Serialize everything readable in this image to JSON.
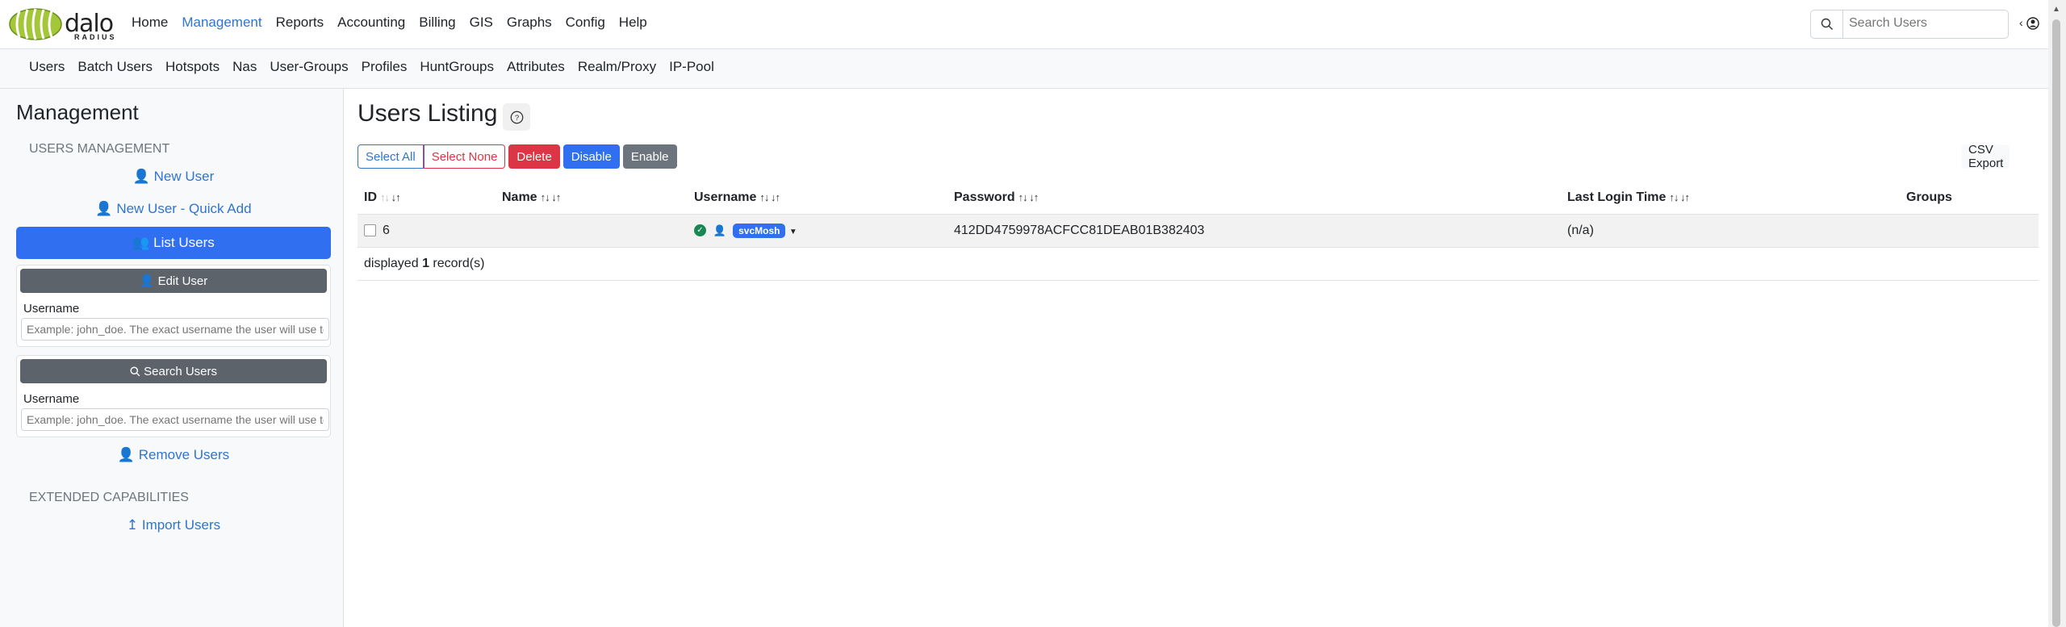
{
  "brand": {
    "logo_text": "dalo",
    "logo_sub": "RADIUS"
  },
  "main_nav": [
    "Home",
    "Management",
    "Reports",
    "Accounting",
    "Billing",
    "GIS",
    "Graphs",
    "Config",
    "Help"
  ],
  "main_nav_active": "Management",
  "search": {
    "placeholder": "Search Users"
  },
  "sub_nav": [
    "Users",
    "Batch Users",
    "Hotspots",
    "Nas",
    "User-Groups",
    "Profiles",
    "HuntGroups",
    "Attributes",
    "Realm/Proxy",
    "IP-Pool"
  ],
  "sidebar": {
    "title": "Management",
    "section_users": "USERS MANAGEMENT",
    "new_user": "New User",
    "new_user_quick": "New User - Quick Add",
    "list_users": "List Users",
    "edit_user": {
      "button": "Edit User",
      "label": "Username",
      "placeholder": "Example: john_doe. The exact username the user will use to log in"
    },
    "search_users": {
      "button": "Search Users",
      "label": "Username",
      "placeholder": "Example: john_doe. The exact username the user will use to log in"
    },
    "remove_users": "Remove Users",
    "section_extended": "EXTENDED CAPABILITIES",
    "import_users": "Import Users"
  },
  "content": {
    "title": "Users Listing",
    "buttons": {
      "select_all": "Select All",
      "select_none": "Select None",
      "delete": "Delete",
      "disable": "Disable",
      "enable": "Enable",
      "csv_export": "CSV Export"
    },
    "columns": [
      "ID",
      "Name",
      "Username",
      "Password",
      "Last Login Time",
      "Groups"
    ],
    "rows": [
      {
        "id": "6",
        "name": "",
        "username": "svcMosh",
        "password": "412DD4759978ACFCC81DEAB01B382403",
        "last_login": "(n/a)",
        "groups": ""
      }
    ],
    "footer_prefix": "displayed",
    "footer_count": "1",
    "footer_suffix": "record(s)"
  },
  "colors": {
    "accent": "#2f6ff0",
    "link": "#2f74d0",
    "danger": "#dc3545",
    "secondary": "#6c757d",
    "success": "#198754"
  }
}
